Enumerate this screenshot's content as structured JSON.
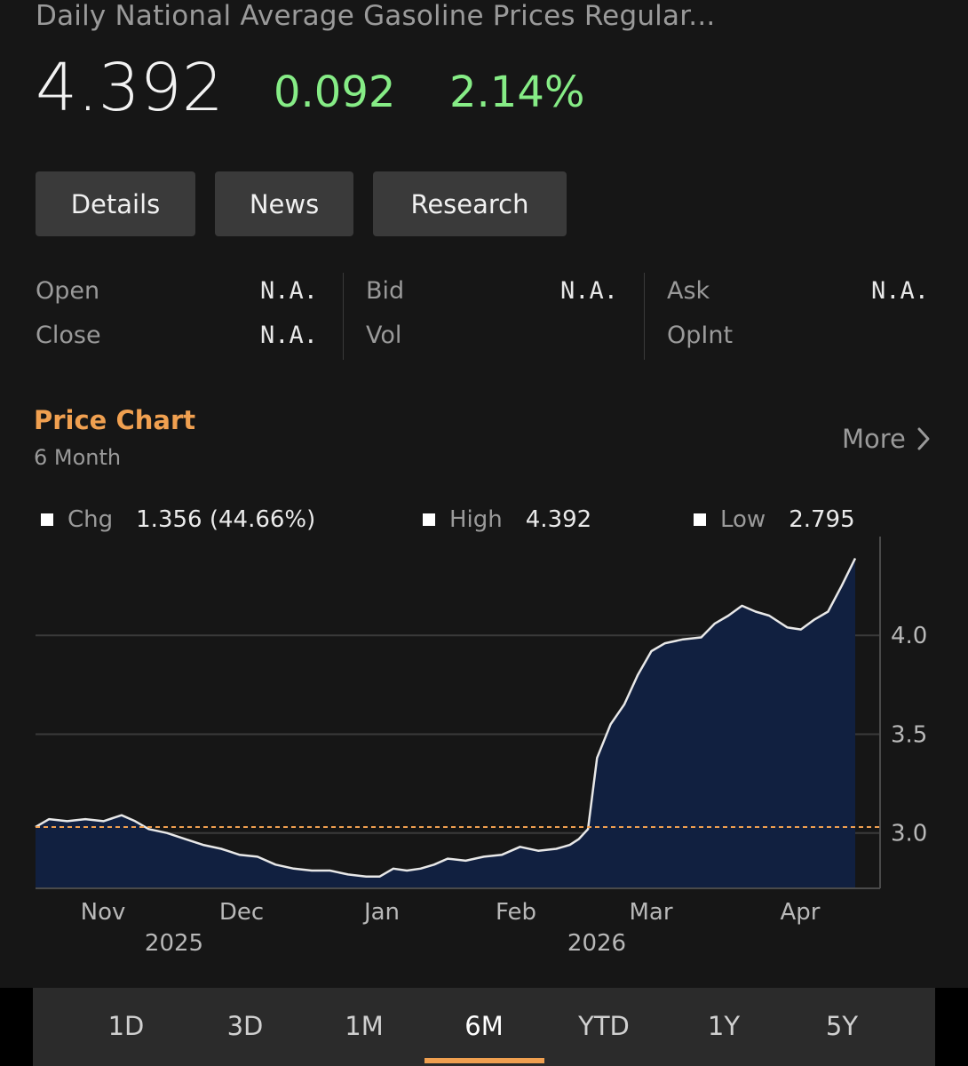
{
  "header": {
    "title": "Daily National Average Gasoline Prices Regular...",
    "price": "4.392",
    "change": "0.092",
    "change_pct": "2.14%",
    "positive_color": "#86ec86"
  },
  "buttons": {
    "details": "Details",
    "news": "News",
    "research": "Research"
  },
  "quote": {
    "open_label": "Open",
    "open_value": "N.A.",
    "close_label": "Close",
    "close_value": "N.A.",
    "bid_label": "Bid",
    "bid_value": "N.A.",
    "vol_label": "Vol",
    "ask_label": "Ask",
    "ask_value": "N.A.",
    "opint_label": "OpInt"
  },
  "price_chart": {
    "title": "Price Chart",
    "period": "6 Month",
    "more_label": "More",
    "accent_color": "#f0a050",
    "legend": {
      "chg_label": "Chg",
      "chg_value": "1.356 (44.66%)",
      "high_label": "High",
      "high_value": "4.392",
      "low_label": "Low",
      "low_value": "2.795"
    }
  },
  "chart_data": {
    "type": "area",
    "x_label_months": [
      "Nov",
      "Dec",
      "Jan",
      "Feb",
      "Mar",
      "Apr"
    ],
    "x_label_years": [
      "2025",
      "2026"
    ],
    "y_ticks": [
      "4.0",
      "3.5",
      "3.0"
    ],
    "ylim": [
      2.72,
      4.5
    ],
    "reference_line": 3.03,
    "grid": "horizontal",
    "fill_color": "#112040",
    "line_color": "#e8e8e8",
    "x": [
      "2025-10-19",
      "2025-10-22",
      "2025-10-26",
      "2025-10-30",
      "2025-11-03",
      "2025-11-07",
      "2025-11-10",
      "2025-11-13",
      "2025-11-17",
      "2025-11-21",
      "2025-11-25",
      "2025-11-29",
      "2025-12-03",
      "2025-12-07",
      "2025-12-11",
      "2025-12-15",
      "2025-12-19",
      "2025-12-23",
      "2025-12-27",
      "2025-12-31",
      "2026-01-03",
      "2026-01-06",
      "2026-01-09",
      "2026-01-12",
      "2026-01-15",
      "2026-01-18",
      "2026-01-22",
      "2026-01-26",
      "2026-01-30",
      "2026-02-03",
      "2026-02-07",
      "2026-02-11",
      "2026-02-14",
      "2026-02-16",
      "2026-02-18",
      "2026-02-20",
      "2026-02-23",
      "2026-02-26",
      "2026-03-01",
      "2026-03-04",
      "2026-03-07",
      "2026-03-11",
      "2026-03-15",
      "2026-03-18",
      "2026-03-21",
      "2026-03-24",
      "2026-03-27",
      "2026-03-30",
      "2026-04-03",
      "2026-04-06",
      "2026-04-09",
      "2026-04-12",
      "2026-04-15",
      "2026-04-18"
    ],
    "values": [
      3.03,
      3.07,
      3.06,
      3.07,
      3.06,
      3.09,
      3.06,
      3.02,
      3.0,
      2.97,
      2.94,
      2.92,
      2.89,
      2.88,
      2.84,
      2.82,
      2.81,
      2.81,
      2.79,
      2.78,
      2.78,
      2.82,
      2.81,
      2.82,
      2.84,
      2.87,
      2.86,
      2.88,
      2.89,
      2.93,
      2.91,
      2.92,
      2.94,
      2.97,
      3.02,
      3.38,
      3.55,
      3.65,
      3.8,
      3.92,
      3.96,
      3.98,
      3.99,
      4.06,
      4.1,
      4.15,
      4.12,
      4.1,
      4.04,
      4.03,
      4.08,
      4.12,
      4.25,
      4.39
    ]
  },
  "range_tabs": [
    "1D",
    "3D",
    "1M",
    "6M",
    "YTD",
    "1Y",
    "5Y"
  ],
  "active_range": "6M"
}
